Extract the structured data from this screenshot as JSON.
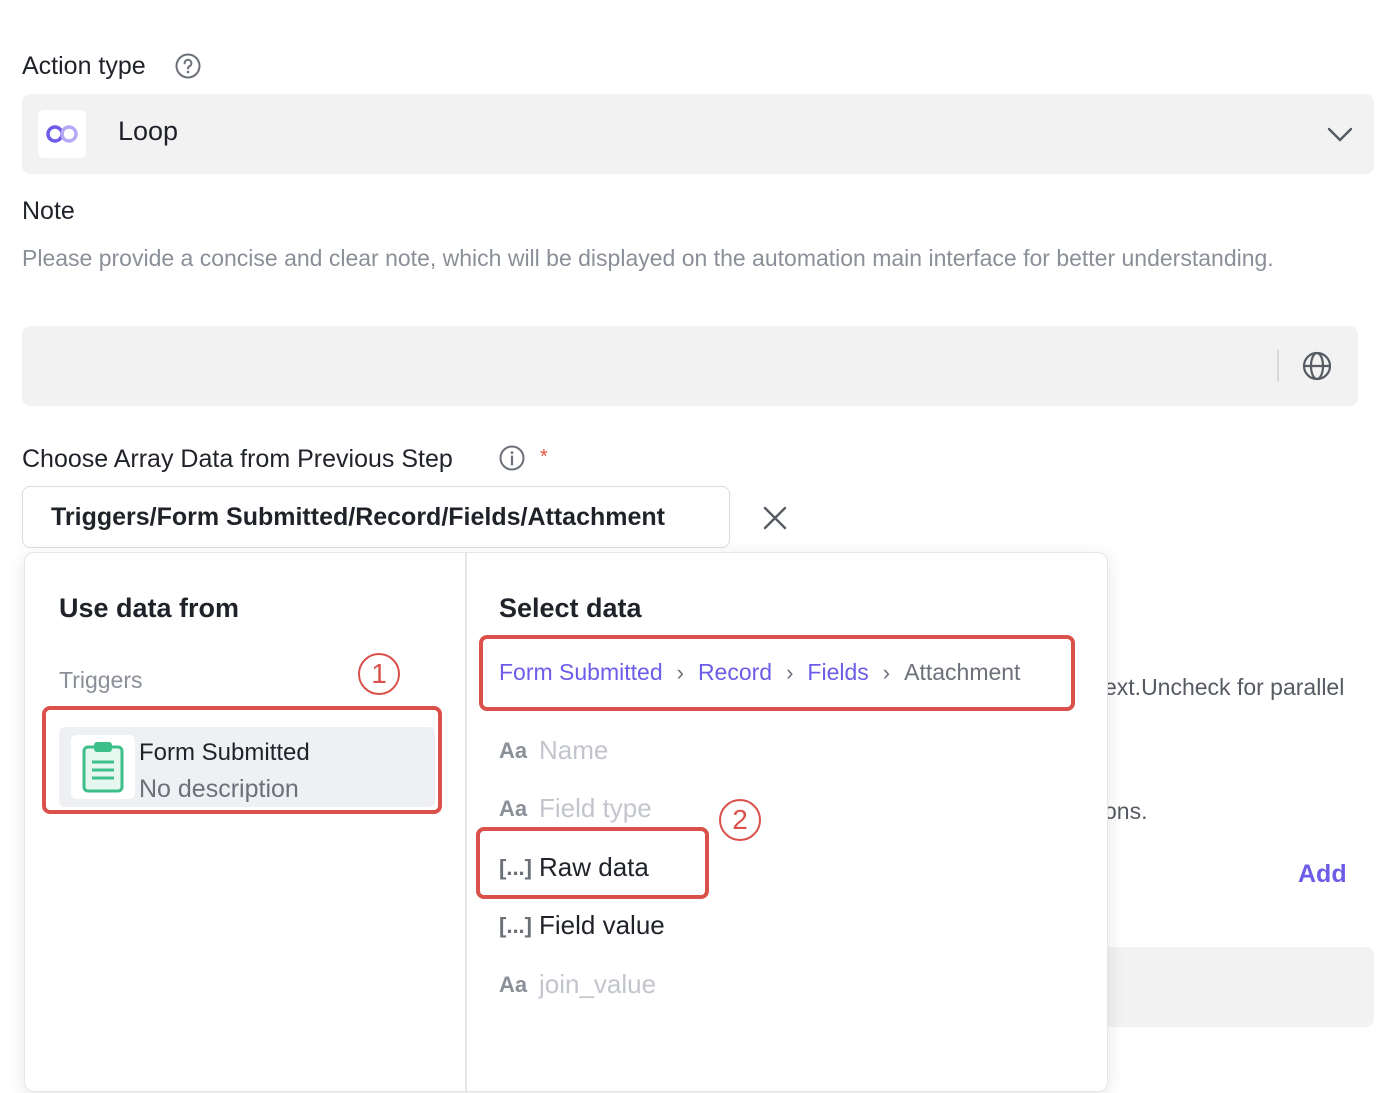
{
  "action_type": {
    "label": "Action type",
    "help_icon": "question-circle-icon",
    "value": "Loop",
    "value_icon": "loop-infinity-icon"
  },
  "note": {
    "label": "Note",
    "description": "Please provide a concise and clear note, which will be displayed on the automation main interface for better understanding.",
    "value": "",
    "translate_icon": "globe-icon"
  },
  "array_source": {
    "label": "Choose Array Data from Previous Step",
    "info_icon": "info-circle-icon",
    "required_mark": "*",
    "value": "Triggers/Form Submitted/Record/Fields/Attachment",
    "clear_icon": "close-icon"
  },
  "background": {
    "partial_text_1": "ext.Uncheck for parallel",
    "partial_text_2": "ons.",
    "add_label": "Add"
  },
  "popup": {
    "left_title": "Use data from",
    "group_label": "Triggers",
    "trigger": {
      "name": "Form Submitted",
      "description": "No description",
      "icon": "clipboard-icon"
    },
    "right_title": "Select data",
    "breadcrumb": [
      "Form Submitted",
      "Record",
      "Fields",
      "Attachment"
    ],
    "breadcrumb_sep": "›",
    "fields": [
      {
        "type": "Aa",
        "label": "Name",
        "enabled": false
      },
      {
        "type": "Aa",
        "label": "Field type",
        "enabled": false
      },
      {
        "type": "[...]",
        "label": "Raw data",
        "enabled": true
      },
      {
        "type": "[...]",
        "label": "Field value",
        "enabled": true
      },
      {
        "type": "Aa",
        "label": "join_value",
        "enabled": false
      }
    ]
  },
  "annotations": {
    "step1": "1",
    "step2": "2",
    "highlight_color": "#d9514a"
  },
  "colors": {
    "accent": "#6d5ce8",
    "input_bg": "#f2f2f2",
    "clipboard": "#3dbf8a"
  }
}
